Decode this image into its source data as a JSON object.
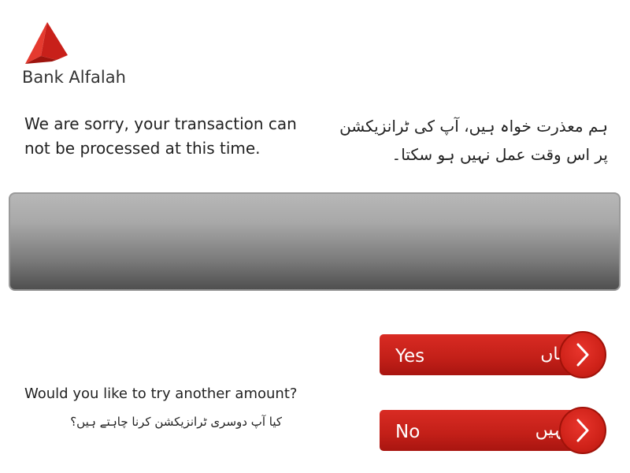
{
  "brand": {
    "name": "Bank Alfalah",
    "logo_icon": "alfalah-logo-icon",
    "accent_color": "#d8262e"
  },
  "message": {
    "english": "We are sorry, your transaction can not be processed at this time.",
    "urdu": "ہم معذرت خواہ ہیں، آپ کی ٹرانزیکشن پر اس وقت عمل نہیں ہو سکتا۔"
  },
  "question": {
    "english": "Would you like to try another amount?",
    "urdu": "کیا آپ دوسری ٹرانزیکشن کرنا چاہتے ہیں؟"
  },
  "buttons": {
    "yes": {
      "label_en": "Yes",
      "label_ur": "ہاں",
      "icon": "chevron-right-icon"
    },
    "no": {
      "label_en": "No",
      "label_ur": "نہیں",
      "icon": "chevron-right-icon"
    }
  }
}
